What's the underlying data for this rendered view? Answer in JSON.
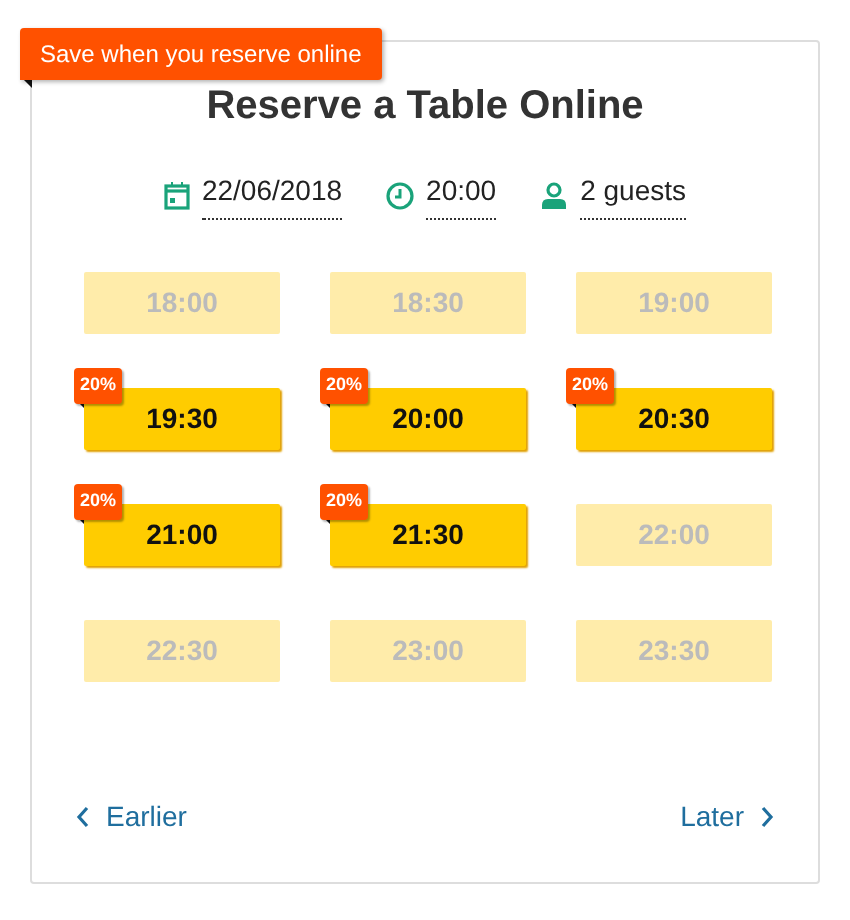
{
  "promo_ribbon": "Save when you reserve online",
  "title": "Reserve a Table Online",
  "filters": [
    {
      "kind": "date",
      "value": "22/06/2018"
    },
    {
      "kind": "time",
      "value": "20:00"
    },
    {
      "kind": "guests",
      "value": "2 guests"
    }
  ],
  "slots": [
    {
      "time": "18:00",
      "available": false
    },
    {
      "time": "18:30",
      "available": false
    },
    {
      "time": "19:00",
      "available": false
    },
    {
      "time": "19:30",
      "available": true,
      "discount": "20%"
    },
    {
      "time": "20:00",
      "available": true,
      "discount": "20%"
    },
    {
      "time": "20:30",
      "available": true,
      "discount": "20%"
    },
    {
      "time": "21:00",
      "available": true,
      "discount": "20%"
    },
    {
      "time": "21:30",
      "available": true,
      "discount": "20%"
    },
    {
      "time": "22:00",
      "available": false
    },
    {
      "time": "22:30",
      "available": false
    },
    {
      "time": "23:00",
      "available": false
    },
    {
      "time": "23:30",
      "available": false
    }
  ],
  "nav": {
    "earlier": "Earlier",
    "later": "Later"
  }
}
